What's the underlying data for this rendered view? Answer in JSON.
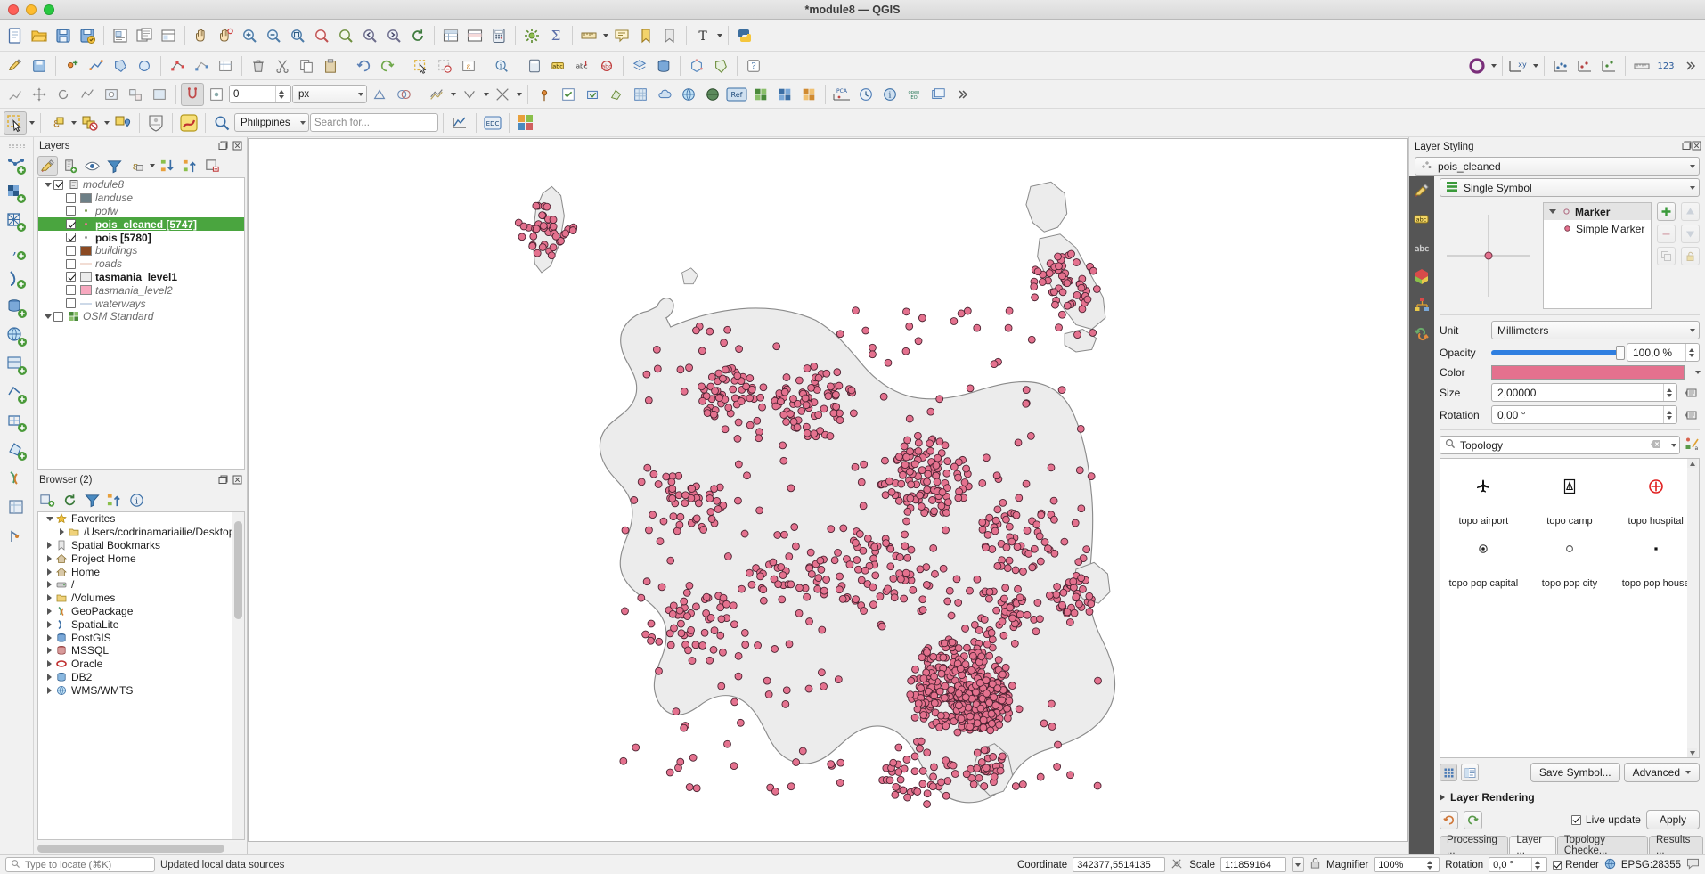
{
  "window": {
    "title": "*module8 — QGIS"
  },
  "layers_panel": {
    "title": "Layers",
    "tools": [
      "open-layer-styling-panel",
      "add-group",
      "manage-map-themes",
      "filter-legend",
      "expression-filter",
      "expand-all",
      "collapse-all",
      "remove-layer"
    ],
    "tree": [
      {
        "label": "module8",
        "type": "group",
        "checked": true,
        "expanded": true,
        "indent": 0,
        "symbol": "group",
        "bold": false
      },
      {
        "label": "landuse",
        "type": "polygon",
        "checked": false,
        "indent": 1,
        "symbol": "swatch",
        "color": "#6d7f86",
        "italic": true
      },
      {
        "label": "pofw",
        "type": "point",
        "checked": false,
        "indent": 1,
        "symbol": "dot",
        "color": "#7e9a55",
        "italic": true
      },
      {
        "label": "pois_cleaned [5747]",
        "type": "point",
        "checked": true,
        "indent": 1,
        "symbol": "dot",
        "color": "#e4718e",
        "selected": true
      },
      {
        "label": "pois [5780]",
        "type": "point",
        "checked": true,
        "indent": 1,
        "symbol": "dot",
        "color": "#9a9a9a",
        "bold": true
      },
      {
        "label": "buildings",
        "type": "polygon",
        "checked": false,
        "indent": 1,
        "symbol": "swatch",
        "color": "#8b4a22",
        "italic": true
      },
      {
        "label": "roads",
        "type": "line",
        "checked": false,
        "indent": 1,
        "symbol": "line",
        "color": "#f2ddd4",
        "italic": true
      },
      {
        "label": "tasmania_level1",
        "type": "polygon",
        "checked": true,
        "indent": 1,
        "symbol": "swatch",
        "color": "#ececec",
        "bold": true
      },
      {
        "label": "tasmania_level2",
        "type": "polygon",
        "checked": false,
        "indent": 1,
        "symbol": "swatch",
        "color": "#f7a8bf",
        "italic": true
      },
      {
        "label": "waterways",
        "type": "line",
        "checked": false,
        "indent": 1,
        "symbol": "line",
        "color": "#cdd9e8",
        "italic": true
      },
      {
        "label": "OSM Standard",
        "type": "group",
        "checked": false,
        "expanded": true,
        "indent": 0,
        "symbol": "xyz",
        "italic": true
      }
    ]
  },
  "browser_panel": {
    "title": "Browser (2)",
    "items": [
      {
        "label": "Favorites",
        "icon": "star-icon",
        "expanded": true,
        "indent": 0
      },
      {
        "label": "/Users/codrinamariailie/Desktop/a",
        "icon": "folder-icon",
        "expanded": false,
        "indent": 1
      },
      {
        "label": "Spatial Bookmarks",
        "icon": "bookmark-icon",
        "expanded": false,
        "indent": 0
      },
      {
        "label": "Project Home",
        "icon": "home-icon",
        "expanded": false,
        "indent": 0
      },
      {
        "label": "Home",
        "icon": "home-icon",
        "expanded": false,
        "indent": 0
      },
      {
        "label": "/",
        "icon": "drive-icon",
        "expanded": false,
        "indent": 0
      },
      {
        "label": "/Volumes",
        "icon": "folder-icon",
        "expanded": false,
        "indent": 0
      },
      {
        "label": "GeoPackage",
        "icon": "geopackage-icon",
        "expanded": false,
        "indent": 0
      },
      {
        "label": "SpatiaLite",
        "icon": "spatialite-icon",
        "expanded": false,
        "indent": 0
      },
      {
        "label": "PostGIS",
        "icon": "postgis-icon",
        "expanded": false,
        "indent": 0
      },
      {
        "label": "MSSQL",
        "icon": "mssql-icon",
        "expanded": false,
        "indent": 0
      },
      {
        "label": "Oracle",
        "icon": "oracle-icon",
        "expanded": false,
        "indent": 0
      },
      {
        "label": "DB2",
        "icon": "db2-icon",
        "expanded": false,
        "indent": 0
      },
      {
        "label": "WMS/WMTS",
        "icon": "wms-icon",
        "expanded": false,
        "indent": 0
      }
    ]
  },
  "toolbars": {
    "offset_value": "0",
    "offset_units": "px",
    "project_combo": "Philippines",
    "search_placeholder": "Search for...",
    "edc_label": "EDC",
    "xy_label": "xy",
    "num_label": "123",
    "pca_label": "PCA",
    "open_eo_label": "open EO",
    "ref_label": "Ref"
  },
  "layer_styling": {
    "title": "Layer Styling",
    "layer_combo": "pois_cleaned",
    "renderer_combo": "Single Symbol",
    "symbol_tree": {
      "root": "Marker",
      "child": "Simple Marker"
    },
    "unit_label": "Unit",
    "unit_value": "Millimeters",
    "opacity_label": "Opacity",
    "opacity_value": "100,0 %",
    "color_label": "Color",
    "color_value": "#e4718e",
    "size_label": "Size",
    "size_value": "2,00000",
    "rotation_label": "Rotation",
    "rotation_value": "0,00 °",
    "search_value": "Topology",
    "symbols": [
      {
        "label": "topo airport",
        "icon": "airplane-icon"
      },
      {
        "label": "topo camp",
        "icon": "camp-icon"
      },
      {
        "label": "topo hospital",
        "icon": "hospital-cross-icon"
      },
      {
        "label": "topo pop capital",
        "icon": "capital-circle-icon"
      },
      {
        "label": "topo pop city",
        "icon": "city-circle-icon"
      },
      {
        "label": "topo pop house",
        "icon": "house-square-icon"
      }
    ],
    "save_symbol_label": "Save Symbol...",
    "advanced_label": "Advanced",
    "layer_rendering_label": "Layer Rendering",
    "live_update_label": "Live update",
    "live_update_checked": true,
    "apply_label": "Apply"
  },
  "panel_tabs": [
    {
      "label": "Processing ...",
      "active": false
    },
    {
      "label": "Layer ...",
      "active": true
    },
    {
      "label": "Topology Checke...",
      "active": false
    },
    {
      "label": "Results ...",
      "active": false
    }
  ],
  "status_bar": {
    "locate_placeholder": "Type to locate (⌘K)",
    "message": "Updated local data sources",
    "coordinate_label": "Coordinate",
    "coordinate_value": "342377,5514135",
    "scale_label": "Scale",
    "scale_value": "1:1859164",
    "magnifier_label": "Magnifier",
    "magnifier_value": "100%",
    "rotation_label": "Rotation",
    "rotation_value": "0,0 °",
    "render_label": "Render",
    "render_checked": true,
    "crs_label": "EPSG:28355"
  }
}
